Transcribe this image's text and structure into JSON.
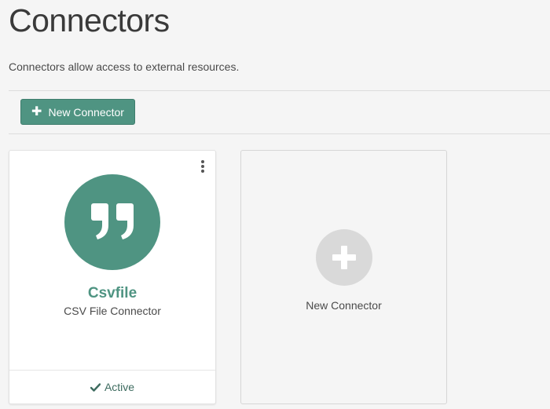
{
  "page": {
    "title": "Connectors",
    "description": "Connectors allow access to external resources."
  },
  "toolbar": {
    "new_connector_label": "New Connector",
    "new_connector_icon": "plus-icon"
  },
  "connectors": [
    {
      "name": "Csvfile",
      "type": "CSV File Connector",
      "icon": "quote-icon",
      "status": "Active",
      "status_icon": "check-icon",
      "menu_icon": "kebab-menu-icon"
    }
  ],
  "new_card": {
    "label": "New Connector",
    "icon": "plus-circle-icon"
  },
  "colors": {
    "accent": "#4f9482",
    "background": "#f5f5f5",
    "card": "#ffffff",
    "status_text": "#3d6b5f",
    "placeholder_circle": "#d9d9d9"
  }
}
